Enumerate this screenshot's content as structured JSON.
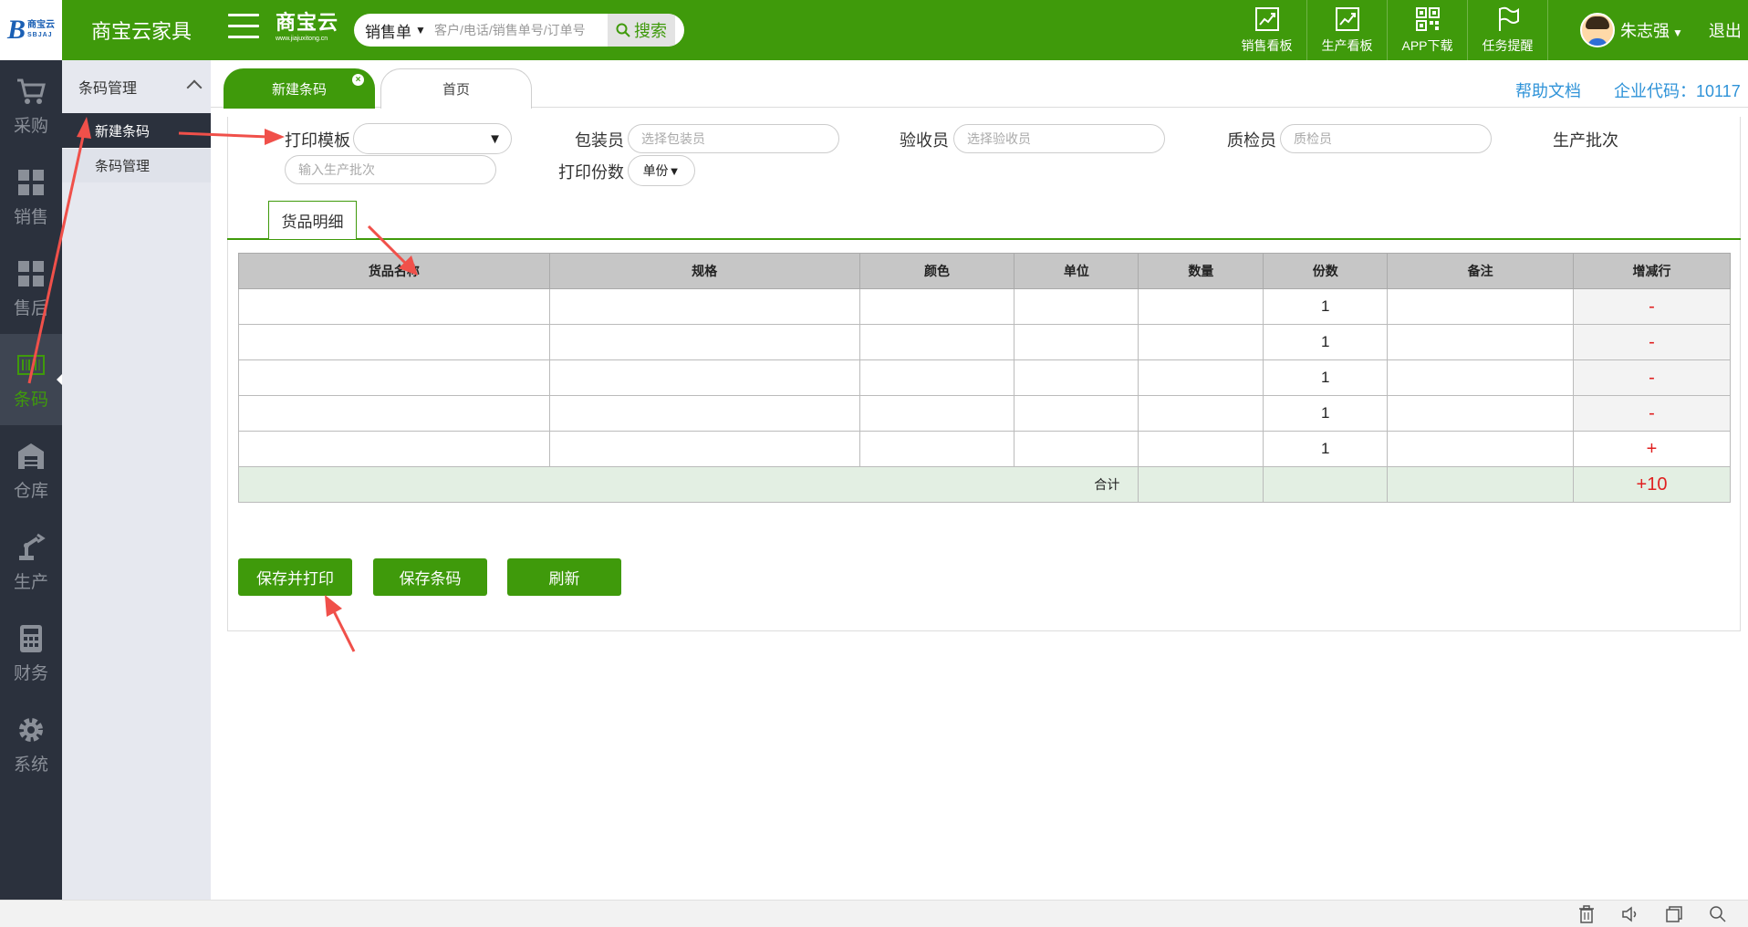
{
  "topbar": {
    "app_name": "商宝云家具",
    "logo_small_top": "商宝云",
    "logo_small_bottom": "SBJAJ",
    "brand_main": "商宝云",
    "brand_sub": "www.jiajuxitong.cn",
    "search_type": "销售单",
    "search_placeholder": "客户/电话/销售单号/订单号",
    "search_button": "搜索",
    "tools": [
      {
        "label": "销售看板",
        "icon": "chart-trend-icon"
      },
      {
        "label": "生产看板",
        "icon": "chart-trend-icon"
      },
      {
        "label": "APP下载",
        "icon": "qr-code-icon"
      },
      {
        "label": "任务提醒",
        "icon": "flag-icon"
      }
    ],
    "user_name": "朱志强",
    "logout": "退出"
  },
  "sidebar": {
    "items": [
      {
        "label": "采购",
        "icon": "cart-icon"
      },
      {
        "label": "销售",
        "icon": "boxes-icon"
      },
      {
        "label": "售后",
        "icon": "boxes-icon"
      },
      {
        "label": "条码",
        "icon": "barcode-icon",
        "active": true
      },
      {
        "label": "仓库",
        "icon": "warehouse-icon"
      },
      {
        "label": "生产",
        "icon": "robot-arm-icon"
      },
      {
        "label": "财务",
        "icon": "calculator-icon"
      },
      {
        "label": "系统",
        "icon": "gear-icon"
      }
    ]
  },
  "subsidebar": {
    "header": "条码管理",
    "items": [
      {
        "label": "新建条码",
        "active": true
      },
      {
        "label": "条码管理",
        "active": false
      }
    ]
  },
  "tabs": [
    {
      "label": "新建条码",
      "active": true
    },
    {
      "label": "首页",
      "active": false
    }
  ],
  "header_right": {
    "help": "帮助文档",
    "company_code": "企业代码：10117"
  },
  "form": {
    "print_template_label": "打印模板",
    "packer_label": "包装员",
    "packer_placeholder": "选择包装员",
    "receiver_label": "验收员",
    "receiver_placeholder": "选择验收员",
    "inspector_label": "质检员",
    "inspector_placeholder": "质检员",
    "batch_label": "生产批次",
    "batch_placeholder": "输入生产批次",
    "copies_label": "打印份数",
    "copies_value": "单份"
  },
  "detail_tab": "货品明细",
  "table": {
    "headers": [
      "货品名称",
      "规格",
      "颜色",
      "单位",
      "数量",
      "份数",
      "备注",
      "增减行"
    ],
    "rows": [
      {
        "name": "",
        "spec": "",
        "color": "",
        "unit": "",
        "qty": "",
        "copies": "1",
        "note": "",
        "op": "-"
      },
      {
        "name": "",
        "spec": "",
        "color": "",
        "unit": "",
        "qty": "",
        "copies": "1",
        "note": "",
        "op": "-"
      },
      {
        "name": "",
        "spec": "",
        "color": "",
        "unit": "",
        "qty": "",
        "copies": "1",
        "note": "",
        "op": "-"
      },
      {
        "name": "",
        "spec": "",
        "color": "",
        "unit": "",
        "qty": "",
        "copies": "1",
        "note": "",
        "op": "-"
      },
      {
        "name": "",
        "spec": "",
        "color": "",
        "unit": "",
        "qty": "",
        "copies": "1",
        "note": "",
        "op": "+"
      }
    ],
    "total_label": "合计",
    "total_op": "+10"
  },
  "buttons": {
    "save_print": "保存并打印",
    "save": "保存条码",
    "refresh": "刷新"
  },
  "colors": {
    "brand_green": "#3f9a0b",
    "sidebar_dark": "#2b313d",
    "link_blue": "#2f93d8",
    "annotation_red": "#f0504a"
  }
}
